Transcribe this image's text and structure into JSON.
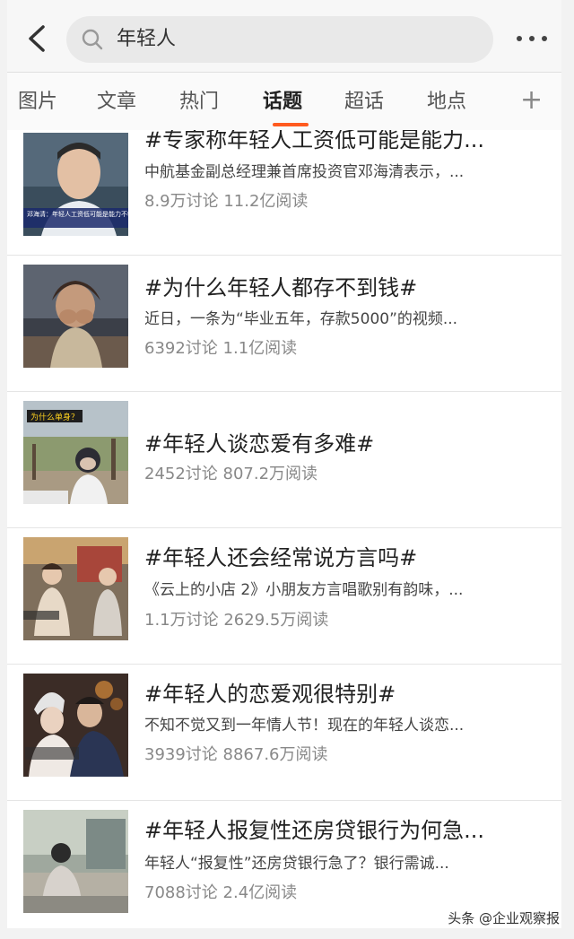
{
  "search": {
    "query": "年轻人"
  },
  "tabs": [
    {
      "label": "图片"
    },
    {
      "label": "文章"
    },
    {
      "label": "热门"
    },
    {
      "label": "话题"
    },
    {
      "label": "超话"
    },
    {
      "label": "地点"
    }
  ],
  "tab_add": "+",
  "results": [
    {
      "title": "#专家称年轻人工资低可能是能力...",
      "desc": "中航基金副总经理兼首席投资官邓海清表示，...",
      "stats": "8.9万讨论 11.2亿阅读",
      "thumb_caption": "邓海清：年轻人工资低可能是能力不够"
    },
    {
      "title": "#为什么年轻人都存不到钱#",
      "desc": "近日，一条为“毕业五年，存款5000”的视频...",
      "stats": "6392讨论 1.1亿阅读"
    },
    {
      "title": "#年轻人谈恋爱有多难#",
      "desc": "",
      "stats": "2452讨论 807.2万阅读",
      "thumb_caption": "为什么单身？"
    },
    {
      "title": "#年轻人还会经常说方言吗#",
      "desc": "《云上的小店 2》小朋友方言唱歌别有韵味，...",
      "stats": "1.1万讨论 2629.5万阅读"
    },
    {
      "title": "#年轻人的恋爱观很特别#",
      "desc": "不知不觉又到一年情人节！现在的年轻人谈恋...",
      "stats": "3939讨论 8867.6万阅读"
    },
    {
      "title": "#年轻人报复性还房贷银行为何急...",
      "desc": "年轻人“报复性”还房贷银行急了？银行需诚...",
      "stats": "7088讨论 2.4亿阅读"
    }
  ],
  "watermark": "头条 @企业观察报"
}
